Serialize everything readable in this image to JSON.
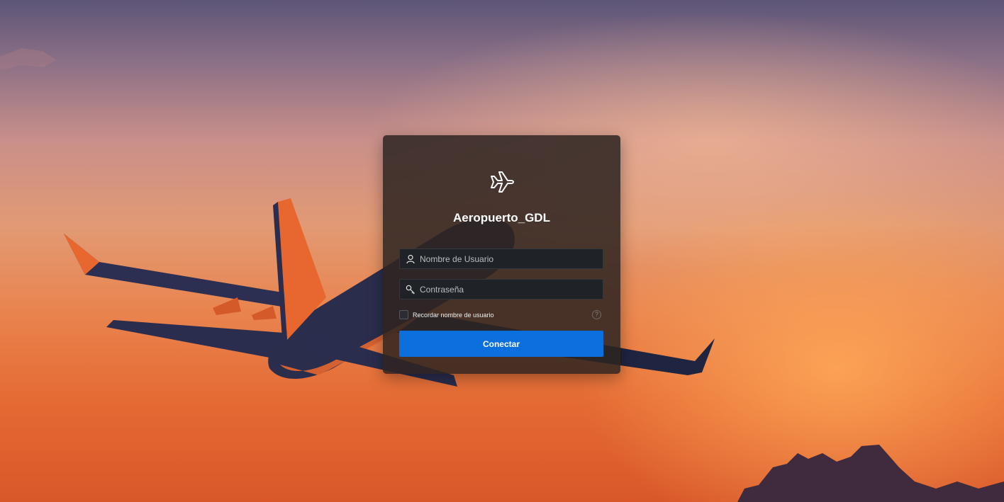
{
  "app": {
    "title": "Aeropuerto_GDL",
    "logo_icon": "airplane-icon"
  },
  "login": {
    "username": {
      "placeholder": "Nombre de Usuario",
      "value": "",
      "icon": "user-icon"
    },
    "password": {
      "placeholder": "Contraseña",
      "value": "",
      "icon": "key-icon"
    },
    "remember_label": "Recordar nombre de usuario",
    "remember_checked": false,
    "help_icon": "help-icon",
    "submit_label": "Conectar"
  },
  "colors": {
    "accent": "#0b6fdd",
    "card": "#2d2421",
    "field": "#1f2226"
  }
}
